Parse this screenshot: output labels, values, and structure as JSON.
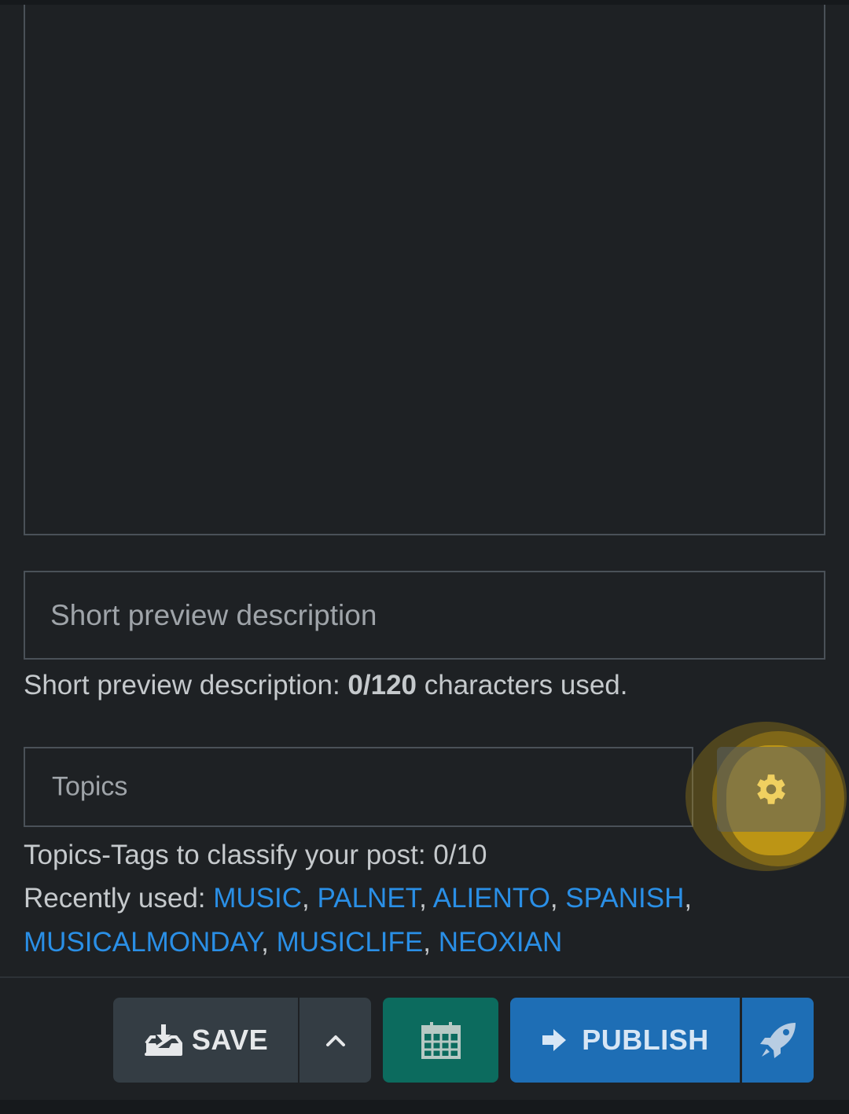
{
  "description_field": {
    "placeholder": "Short preview description",
    "helper_prefix": "Short preview description: ",
    "helper_count": "0/120",
    "helper_suffix": " characters used."
  },
  "topics_field": {
    "placeholder": "Topics",
    "helper": "Topics-Tags to classify your post: 0/10",
    "gear_icon": "gear-icon"
  },
  "recent_tags": {
    "label": "Recently used: ",
    "tags": [
      "MUSIC",
      "PALNET",
      "ALIENTO",
      "SPANISH",
      "MUSICALMONDAY",
      "MUSICLIFE",
      "NEOXIAN"
    ]
  },
  "footer": {
    "save_label": "SAVE",
    "publish_label": "PUBLISH",
    "icons": {
      "save": "download-tray-icon",
      "save_more": "chevron-up-icon",
      "schedule": "calendar-icon",
      "publish": "arrow-right-icon",
      "publish_now": "rocket-icon"
    }
  },
  "colors": {
    "background": "#1e2124",
    "link": "#2a8fe6",
    "save_button": "#343d44",
    "schedule_button": "#0c6b5e",
    "publish_button": "#1e6eb5",
    "highlight": "#c49810"
  }
}
